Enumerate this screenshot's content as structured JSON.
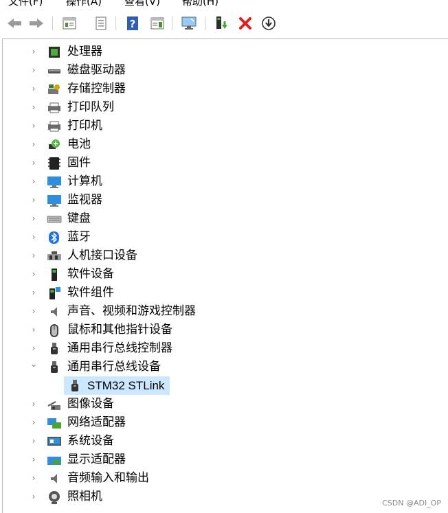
{
  "menu": [
    "文件(F)",
    "操作(A)",
    "查看(V)",
    "帮助(H)"
  ],
  "toolbar": [
    "back-arrow",
    "forward-arrow",
    "properties-panel",
    "show-hidden",
    "help",
    "action-pane",
    "scan-hardware",
    "add-driver",
    "uninstall",
    "update-driver"
  ],
  "tree": [
    {
      "label": "处理器",
      "icon": "processor-icon",
      "expanded": false
    },
    {
      "label": "磁盘驱动器",
      "icon": "disk-drive-icon",
      "expanded": false
    },
    {
      "label": "存储控制器",
      "icon": "storage-controller-icon",
      "expanded": false
    },
    {
      "label": "打印队列",
      "icon": "print-queue-icon",
      "expanded": false
    },
    {
      "label": "打印机",
      "icon": "printer-icon",
      "expanded": false
    },
    {
      "label": "电池",
      "icon": "battery-icon",
      "expanded": false
    },
    {
      "label": "固件",
      "icon": "firmware-icon",
      "expanded": false
    },
    {
      "label": "计算机",
      "icon": "computer-icon",
      "expanded": false
    },
    {
      "label": "监视器",
      "icon": "monitor-icon",
      "expanded": false
    },
    {
      "label": "键盘",
      "icon": "keyboard-icon",
      "expanded": false
    },
    {
      "label": "蓝牙",
      "icon": "bluetooth-icon",
      "expanded": false
    },
    {
      "label": "人机接口设备",
      "icon": "hid-icon",
      "expanded": false
    },
    {
      "label": "软件设备",
      "icon": "software-device-icon",
      "expanded": false
    },
    {
      "label": "软件组件",
      "icon": "software-component-icon",
      "expanded": false
    },
    {
      "label": "声音、视频和游戏控制器",
      "icon": "sound-icon",
      "expanded": false
    },
    {
      "label": "鼠标和其他指针设备",
      "icon": "mouse-icon",
      "expanded": false
    },
    {
      "label": "通用串行总线控制器",
      "icon": "usb-icon",
      "expanded": false
    },
    {
      "label": "通用串行总线设备",
      "icon": "usb-icon",
      "expanded": true
    },
    {
      "label": "STM32 STLink",
      "icon": "usb-icon",
      "child": true,
      "selected": true
    },
    {
      "label": "图像设备",
      "icon": "imaging-icon",
      "expanded": false
    },
    {
      "label": "网络适配器",
      "icon": "network-icon",
      "expanded": false
    },
    {
      "label": "系统设备",
      "icon": "system-device-icon",
      "expanded": false
    },
    {
      "label": "显示适配器",
      "icon": "display-adapter-icon",
      "expanded": false
    },
    {
      "label": "音频输入和输出",
      "icon": "audio-io-icon",
      "expanded": false
    },
    {
      "label": "照相机",
      "icon": "camera-icon",
      "expanded": false
    }
  ],
  "watermark": "CSDN @ADI_OP",
  "colors": {
    "selection": "#cce8ff",
    "accent": "#1e6fd9",
    "danger": "#e02020"
  }
}
